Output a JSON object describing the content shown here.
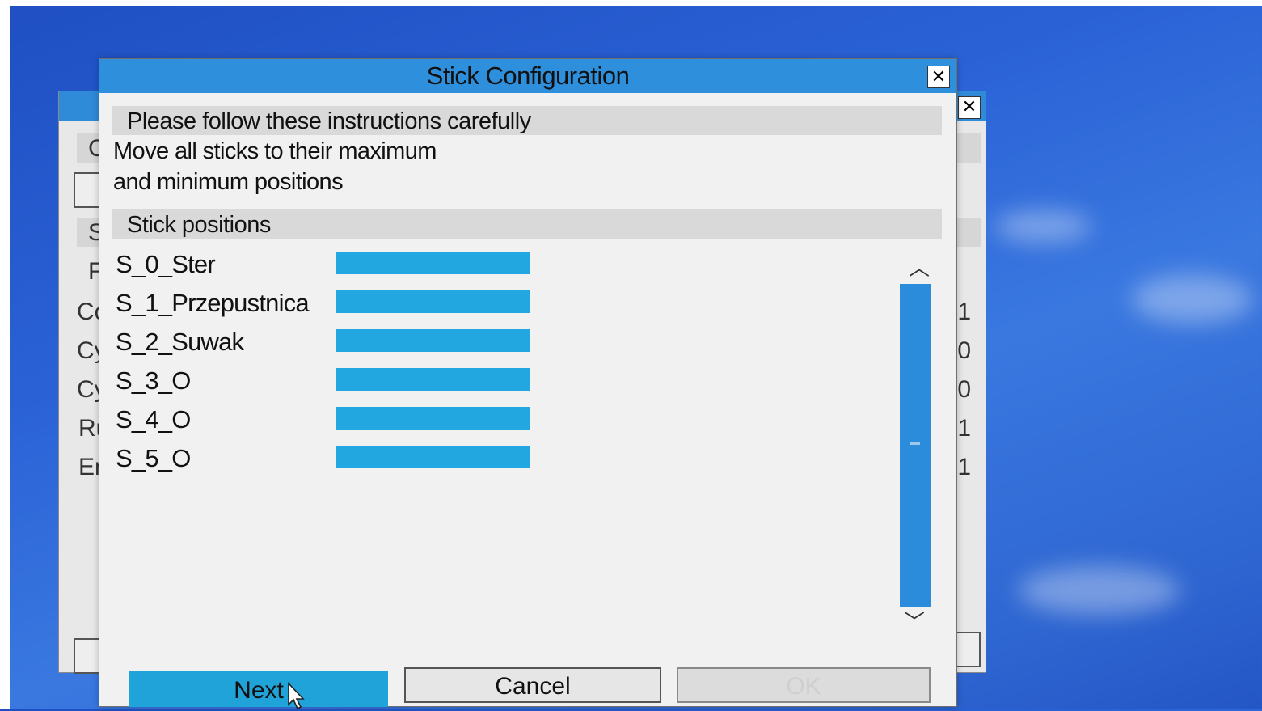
{
  "dialog": {
    "title": "Stick Configuration",
    "instructions_header": "Please follow these instructions carefully",
    "instruction_line1": "Move all sticks to their maximum",
    "instruction_line2": "and minimum positions",
    "positions_header": "Stick positions",
    "sticks": [
      {
        "name": "S_0_Ster"
      },
      {
        "name": "S_1_Przepustnica"
      },
      {
        "name": "S_2_Suwak"
      },
      {
        "name": "S_3_O"
      },
      {
        "name": "S_4_O"
      },
      {
        "name": "S_5_O"
      }
    ],
    "buttons": {
      "next": "Next",
      "cancel": "Cancel",
      "ok": "OK"
    }
  },
  "background_window": {
    "labels": [
      "C",
      "S",
      "F",
      "Co",
      "Cy",
      "Cy",
      "Ru",
      "En"
    ],
    "values": [
      "1",
      "0",
      "0",
      "1",
      "1"
    ]
  },
  "colors": {
    "titlebar": "#2e8fdc",
    "stick_bar": "#23a7e0",
    "next_button": "#1fa3d8",
    "desktop": "#2a62d6"
  }
}
